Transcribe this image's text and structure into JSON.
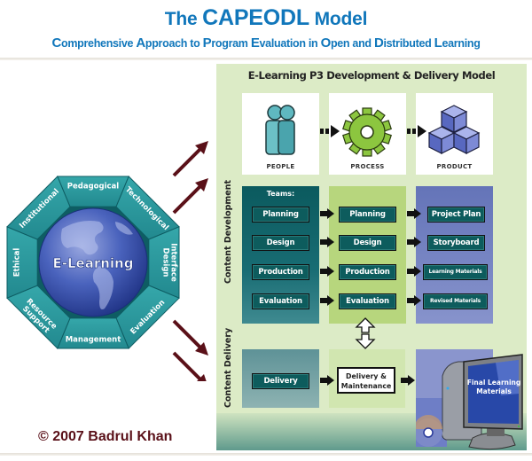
{
  "header": {
    "title_prefix": "The ",
    "title_main": "CAPEODL",
    "title_suffix": " Model",
    "subtitle_words": [
      {
        "cap": "C",
        "rest": "omprehensive "
      },
      {
        "cap": "A",
        "rest": "pproach to "
      },
      {
        "cap": "P",
        "rest": "rogram "
      },
      {
        "cap": "E",
        "rest": "valuation in "
      },
      {
        "cap": "O",
        "rest": "pen and "
      },
      {
        "cap": "D",
        "rest": "istributed "
      },
      {
        "cap": "L",
        "rest": "earning"
      }
    ]
  },
  "octagon": {
    "center_label": "E-Learning",
    "segments": [
      "Pedagogical",
      "Technological",
      "Interface Design",
      "Evaluation",
      "Management",
      "Resource Support",
      "Ethical",
      "Institutional"
    ],
    "colors": {
      "segment": "#2a9a9e",
      "border": "#0e5d63",
      "globe": "#3c55b0"
    }
  },
  "copyright": "© 2007 Badrul Khan",
  "model": {
    "title": "E-Learning P3 Development & Delivery Model",
    "p3": [
      {
        "label": "PEOPLE",
        "icon": "people-icon"
      },
      {
        "label": "PROCESS",
        "icon": "gear-icon"
      },
      {
        "label": "PRODUCT",
        "icon": "cubes-icon"
      }
    ],
    "content_development": {
      "section_label": "Content Development",
      "teams_label": "Teams:",
      "teams": [
        "Planning",
        "Design",
        "Production",
        "Evaluation"
      ],
      "process": [
        "Planning",
        "Design",
        "Production",
        "Evaluation"
      ],
      "products": [
        "Project Plan",
        "Storyboard",
        "Learning Materials",
        "Revised Materials"
      ]
    },
    "content_delivery": {
      "section_label": "Content Delivery",
      "team": "Delivery",
      "process_line1": "Delivery &",
      "process_line2": "Maintenance",
      "product_line1": "Final Learning",
      "product_line2": "Materials"
    },
    "colors": {
      "panel": "#dcebc6",
      "teams_col": "#0b5a5e",
      "process_col": "#b7d67d",
      "product_col": "#6f7fc0",
      "arrow_maroon": "#5a1018"
    }
  }
}
